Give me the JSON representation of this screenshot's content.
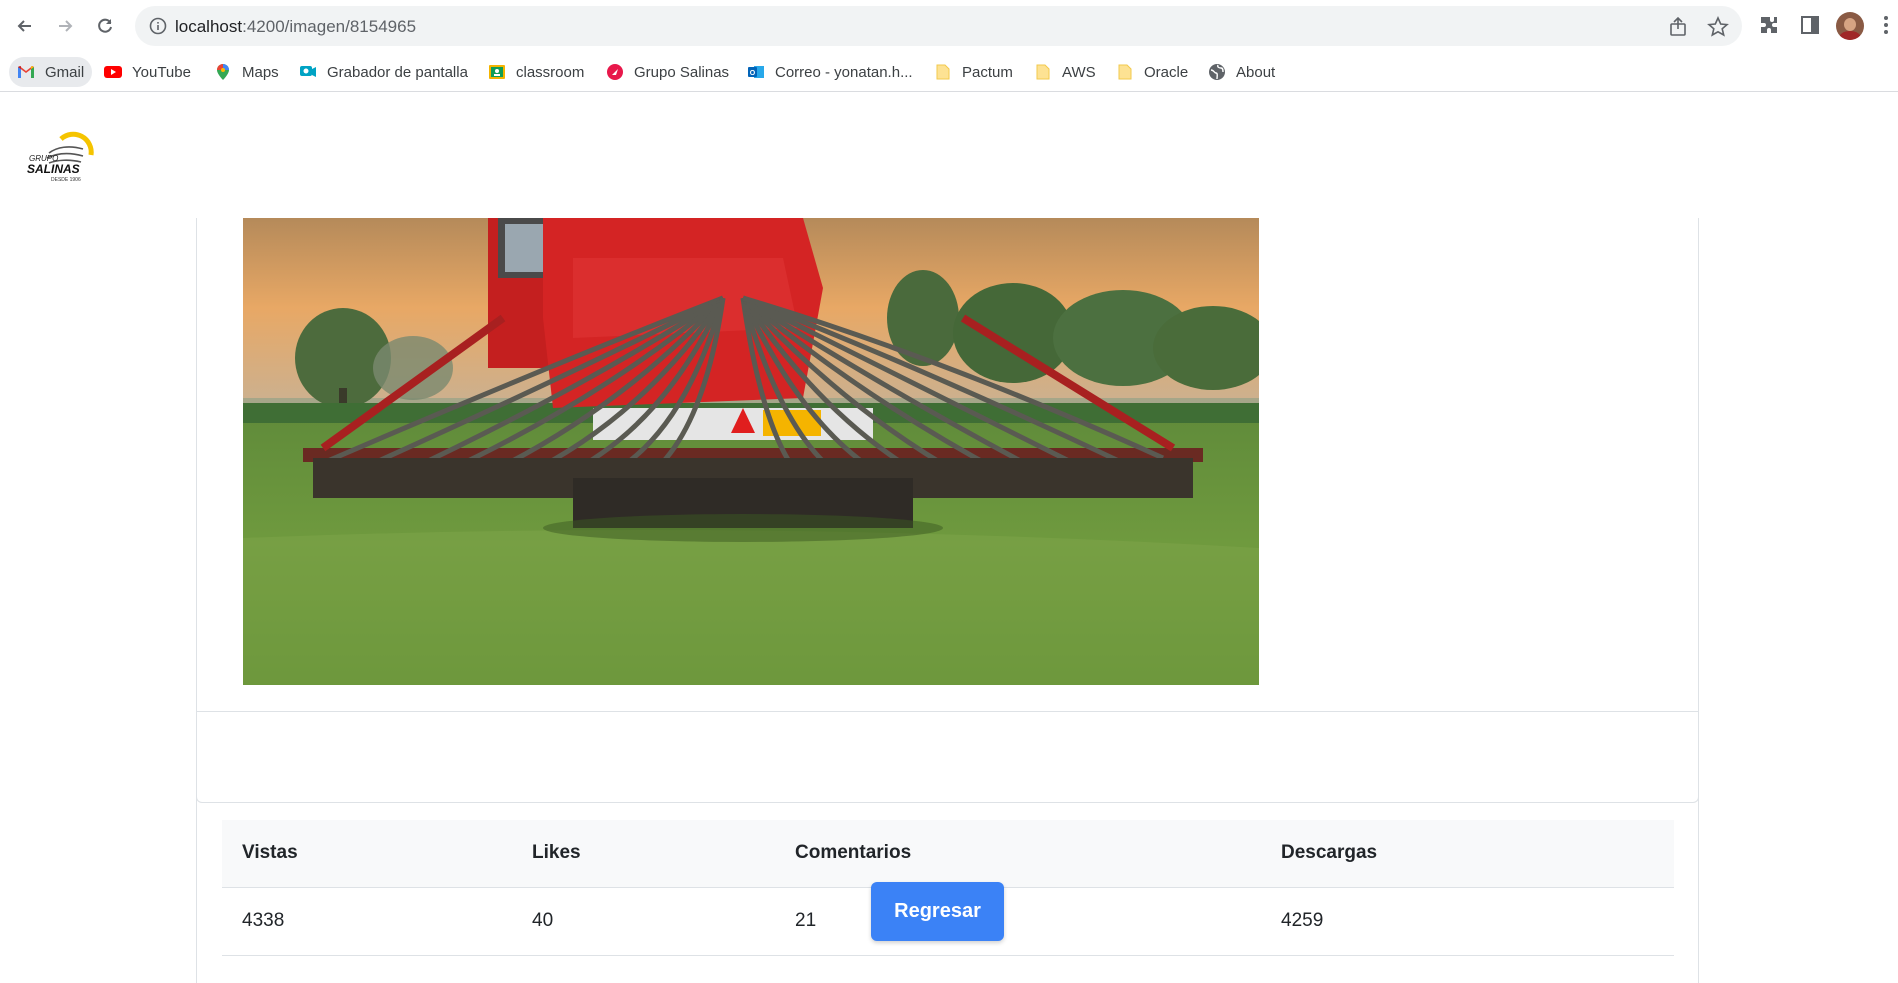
{
  "browser": {
    "url_host": "localhost",
    "url_path": ":4200/imagen/8154965"
  },
  "bookmarks": [
    {
      "label": "Gmail",
      "icon": "gmail-icon"
    },
    {
      "label": "YouTube",
      "icon": "youtube-icon"
    },
    {
      "label": "Maps",
      "icon": "maps-icon"
    },
    {
      "label": "Grabador de pantalla",
      "icon": "screen-recorder-icon"
    },
    {
      "label": "classroom",
      "icon": "classroom-icon"
    },
    {
      "label": "Grupo Salinas",
      "icon": "grupo-salinas-icon"
    },
    {
      "label": "Correo - yonatan.h...",
      "icon": "outlook-icon"
    },
    {
      "label": "Pactum",
      "icon": "folder-icon"
    },
    {
      "label": "AWS",
      "icon": "folder-icon"
    },
    {
      "label": "Oracle",
      "icon": "folder-icon"
    },
    {
      "label": "About",
      "icon": "globe-icon"
    }
  ],
  "logo": {
    "line1": "GRUPO",
    "line2": "SALINAS",
    "line3": "DESDE 1906"
  },
  "stats": {
    "headers": [
      "Vistas",
      "Likes",
      "Comentarios",
      "Descargas"
    ],
    "values": [
      "4338",
      "40",
      "21",
      "4259"
    ]
  },
  "actions": {
    "back_label": "Regresar"
  },
  "colors": {
    "primary_button": "#3b82f6",
    "table_header_bg": "#f8f9fa"
  }
}
